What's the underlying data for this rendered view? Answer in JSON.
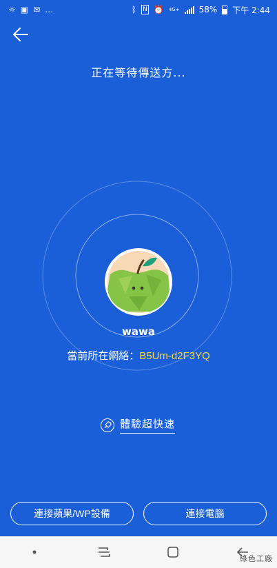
{
  "status_bar": {
    "battery": "58%",
    "time": "下午 2:44",
    "network_badge": "4G+",
    "icons": [
      "brightness-icon",
      "image-icon",
      "mail-icon",
      "more-icon",
      "bluetooth-icon",
      "nfc-icon",
      "alarm-icon",
      "signal-icon",
      "battery-icon"
    ]
  },
  "header": {
    "back_icon": "arrow-left-icon",
    "title": "正在等待傳送方..."
  },
  "profile": {
    "username": "wawa",
    "network_label": "當前所在網絡：",
    "network_name": "B5Um-d2F3YQ"
  },
  "speed_link": {
    "icon": "rocket-icon",
    "label": "體驗超快速"
  },
  "buttons": {
    "connect_apple": "連接蘋果/WP設備",
    "connect_pc": "連接電腦"
  },
  "nav": {
    "items": [
      "dot-icon",
      "recent-apps-icon",
      "home-icon",
      "back-icon"
    ]
  },
  "watermark": "綠色工廠",
  "colors": {
    "background": "#1a5fd7",
    "ssid": "#ffd83a",
    "avatar_green": "#7fc241"
  }
}
